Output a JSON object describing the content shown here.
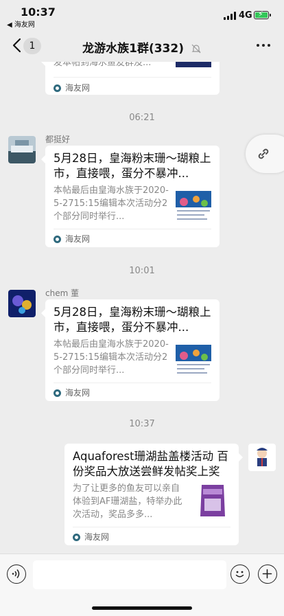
{
  "status": {
    "time": "10:37",
    "back_app": "◀ 海友网",
    "network": "4G"
  },
  "nav": {
    "unread_count": "1",
    "title": "龙游水族1群(332)"
  },
  "messages": [
    {
      "type": "card",
      "desc_lines": [
        "发本帖到海水鱼友群及..."
      ],
      "source": "海友网"
    },
    {
      "type": "timestamp",
      "text": "06:21"
    },
    {
      "type": "card",
      "sender": "都挺好",
      "title": "5月28日，皇海粉末珊～瑚粮上市，直接喂，蛋分不暴冲...",
      "desc": "本帖最后由皇海水族于2020-5-2715:15编辑本次活动分2个部分同时举行...",
      "source": "海友网"
    },
    {
      "type": "timestamp",
      "text": "10:01"
    },
    {
      "type": "card",
      "sender": "chem 董",
      "title": "5月28日，皇海粉末珊～瑚粮上市，直接喂，蛋分不暴冲...",
      "desc": "本帖最后由皇海水族于2020-5-2715:15编辑本次活动分2个部分同时举行...",
      "source": "海友网"
    },
    {
      "type": "timestamp",
      "text": "10:37"
    },
    {
      "type": "card",
      "title": "Aquaforest珊湖盐盖楼活动 百份奖品大放送尝鲜发帖奖上奖",
      "desc": "为了让更多的鱼友可以亲自体验到AF珊湖盐，特举办此次活动，奖品多多...",
      "source": "海友网"
    }
  ],
  "colors": {
    "background": "#ededed",
    "card": "#ffffff",
    "battery": "#34c759"
  },
  "icons": [
    "back-chevron-icon",
    "mute-bell-icon",
    "more-dots-icon",
    "link-icon",
    "voice-icon",
    "emoji-icon",
    "plus-icon",
    "source-logo-icon"
  ]
}
